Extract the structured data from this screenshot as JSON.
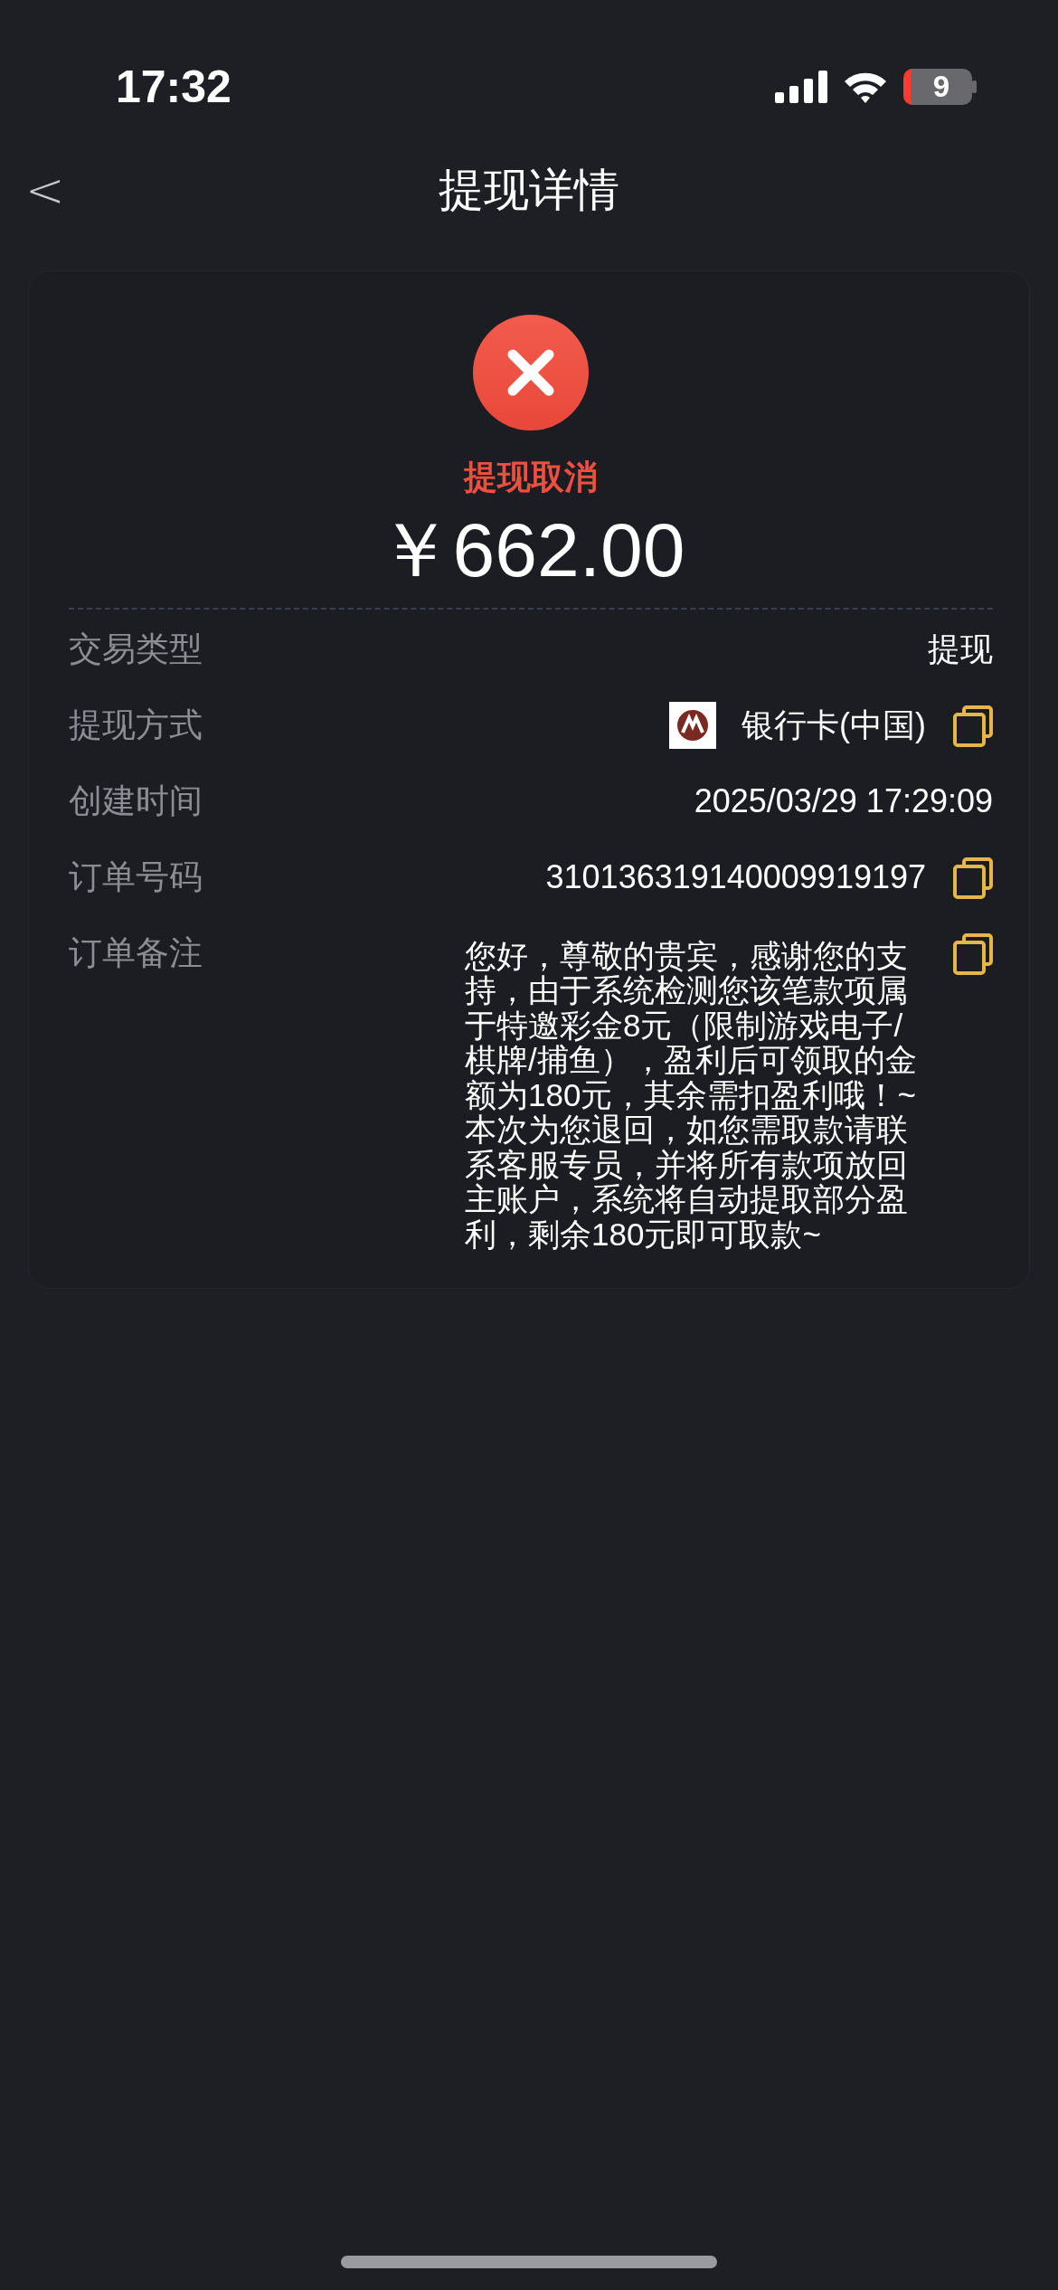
{
  "status_bar": {
    "time": "17:32",
    "battery": "9"
  },
  "nav": {
    "back": "<",
    "title": "提现详情"
  },
  "result": {
    "kind": "cancelled",
    "status": "提现取消",
    "amount": "￥662.00"
  },
  "rows": [
    {
      "kind": "plain",
      "label": "交易类型",
      "value": "提现"
    },
    {
      "kind": "bank",
      "label": "提现方式",
      "value": "银行卡(中国)"
    },
    {
      "kind": "plain",
      "label": "创建时间",
      "value": "2025/03/29 17:29:09"
    },
    {
      "kind": "copy",
      "label": "订单号码",
      "value": "310136319140009919197"
    },
    {
      "kind": "note",
      "label": "订单备注",
      "value": "您好，尊敬的贵宾，感谢您的支持，由于系统检测您该笔款项属于特邀彩金8元（限制游戏电子/棋牌/捕鱼），盈利后可领取的金额为180元，其余需扣盈利哦！~本次为您退回，如您需取款请联系客服专员，并将所有款项放回主账户，系统将自动提取部分盈利，剩余180元即可取款~"
    }
  ]
}
